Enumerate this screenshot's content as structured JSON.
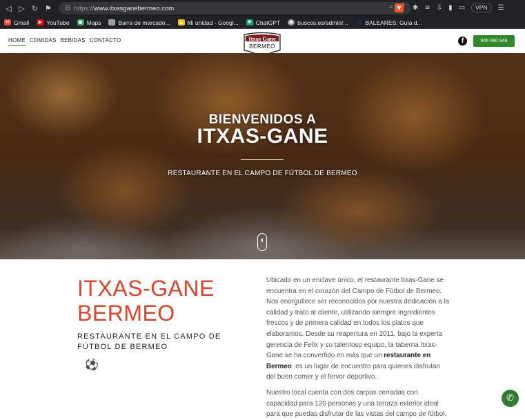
{
  "browser": {
    "url_scheme": "https://",
    "url_host": "www.itxasganebermeo.com",
    "vpn_label": "VPN",
    "bookmarks": [
      {
        "label": "Gmail",
        "color": "#ea4335"
      },
      {
        "label": "YouTube",
        "color": "#ff0000"
      },
      {
        "label": "Maps",
        "color": "#34a853"
      },
      {
        "label": "Barra de marcado...",
        "color": "#9aa0a6"
      },
      {
        "label": "Mi unidad - Googl...",
        "color": "#fbbc04"
      },
      {
        "label": "ChatGPT",
        "color": "#10a37f"
      },
      {
        "label": "buscos.es/admin/...",
        "color": "#9aa0a6"
      },
      {
        "label": "BALEARES: Guía d...",
        "color": "#4285f4"
      }
    ]
  },
  "site": {
    "nav": [
      "HOME",
      "COMIDAS",
      "BEBIDAS",
      "CONTACTO"
    ],
    "logo_line1": "Itxas Gane",
    "logo_line2": "BERMEO",
    "facebook_icon_label": "f",
    "phone": "946 880 946"
  },
  "hero": {
    "welcome": "BIENVENIDOS A",
    "name": "ITXAS-GANE",
    "subtitle": "RESTAURANTE EN EL CAMPO DE FÚTBOL DE BERMEO"
  },
  "content": {
    "title_line1": "ITXAS-GANE",
    "title_line2": "BERMEO",
    "subtitle": "RESTAURANTE EN EL CAMPO DE FÚTBOL DE BERMEO",
    "ball_icon": "⚽",
    "paragraph1_a": "Ubicado en un enclave único, el restaurante Itxas-Gane se encuentra en el corazón del Campo de Fútbol de Bermeo. Nos enorgullece ser reconocidos por nuestra dedicación a la calidad y trato al cliente, utilizando siempre ingredientes frescos y de primera calidad en todos los platos que elaboramos. Desde su reapertura en 2011, bajo la experta gerencia de Felix y su talentoso equipo, la taberna Itxas-Gane se ha convertido en más que un ",
    "paragraph1_bold": "restaurante en Bermeo",
    "paragraph1_b": ": es un lugar de encuentro para quienes disfrutan del buen comer y el fervor deportivo.",
    "paragraph2": "Nuestro local cuenta con dos carpas cerradas con capacidad para 120 personas y una terraza exterior ideal para que puedas disfrutar de las vistas del campo de fútbol."
  }
}
